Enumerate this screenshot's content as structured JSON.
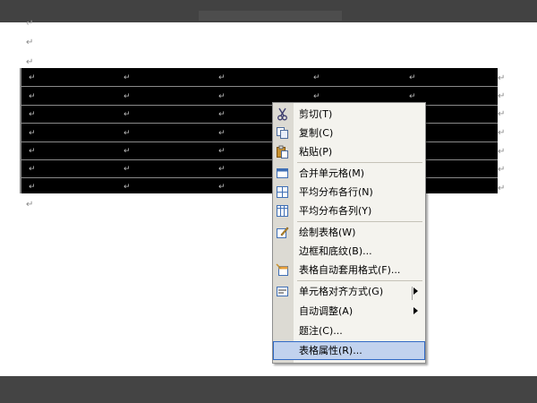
{
  "paragraph_mark": "↵",
  "menu": {
    "items": [
      {
        "label": "剪切(T)",
        "icon": "scissors-icon"
      },
      {
        "label": "复制(C)",
        "icon": "copy-icon"
      },
      {
        "label": "粘贴(P)",
        "icon": "paste-icon"
      },
      {
        "label": "合并单元格(M)",
        "icon": "merge-cells-icon"
      },
      {
        "label": "平均分布各行(N)",
        "icon": "distribute-rows-icon"
      },
      {
        "label": "平均分布各列(Y)",
        "icon": "distribute-columns-icon"
      },
      {
        "label": "绘制表格(W)",
        "icon": "draw-table-icon"
      },
      {
        "label": "边框和底纹(B)...",
        "icon": ""
      },
      {
        "label": "表格自动套用格式(F)...",
        "icon": "table-autoformat-icon"
      },
      {
        "label": "单元格对齐方式(G)",
        "icon": "cell-alignment-icon"
      },
      {
        "label": "自动调整(A)",
        "icon": ""
      },
      {
        "label": "题注(C)...",
        "icon": ""
      },
      {
        "label": "表格属性(R)...",
        "icon": ""
      }
    ],
    "selected_index": 12
  },
  "colors": {
    "highlight_bg": "#c1d2ee",
    "highlight_border": "#316ac5",
    "table_selected": "#000000"
  }
}
